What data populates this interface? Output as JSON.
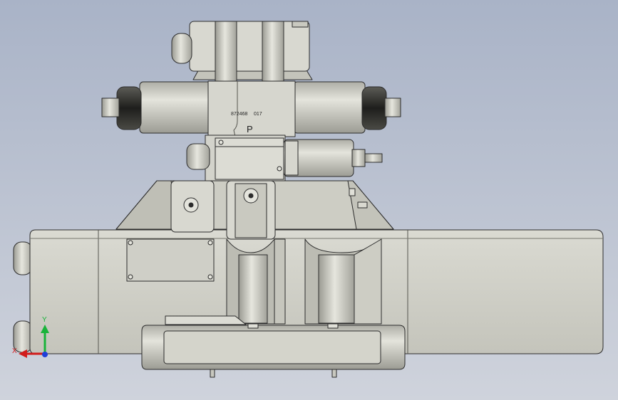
{
  "viewport": {
    "background_top": "#a9b3c7",
    "background_bottom": "#cfd3dc",
    "body_fill": "#d2d2ca",
    "outline_color": "#2c2c2c"
  },
  "part": {
    "nameplate_number": "872468",
    "nameplate_code": "017",
    "port_label": "P"
  },
  "triad": {
    "y_label": "Y",
    "x_label": "X",
    "y_color": "#19b33a",
    "x_color": "#d11c1c",
    "z_color": "#1f3fd8"
  }
}
